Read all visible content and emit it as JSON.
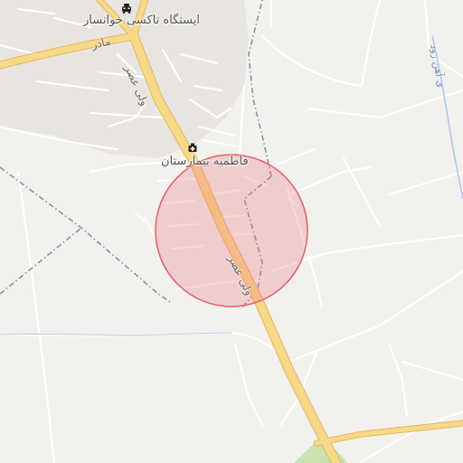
{
  "map": {
    "labels": {
      "taxi_station": "ایستگاه تاکسی خوانسار",
      "hospital": "فاطمیه بیمارستان",
      "main_road_upper": "ولی عصر",
      "main_road_lower": "ولی عصر",
      "side_road": "مادر",
      "river": "ی آهن رود"
    },
    "icons": {
      "taxi": "taxi-icon",
      "hospital": "hospital-icon"
    },
    "colors": {
      "background": "#f3f1ee",
      "built_area": "#e6e3df",
      "main_road": "#f5d27a",
      "main_road_casing": "#e8b65a",
      "minor_road": "#ffffff",
      "boundary": "#8a8a9a",
      "water": "#a9c6e8",
      "park": "#c8e2b0",
      "highlight_fill": "rgba(240,120,130,0.30)",
      "highlight_stroke": "#e0606a"
    }
  }
}
